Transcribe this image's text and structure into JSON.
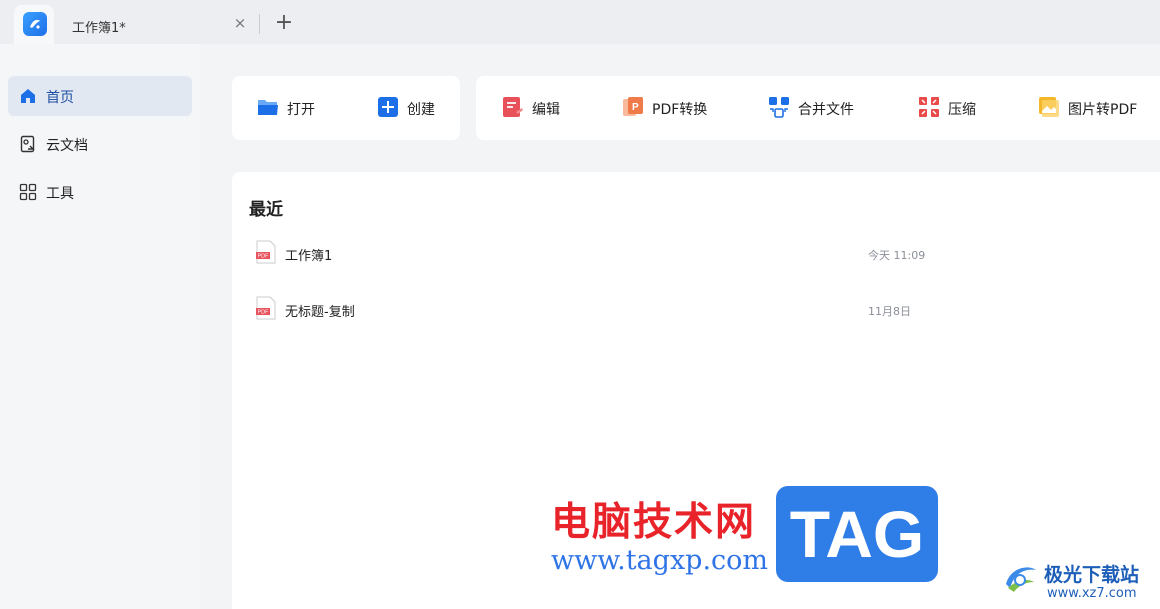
{
  "tabbar": {
    "doc_tab_title": "工作簿1*",
    "close_glyph": "×",
    "new_tab_glyph": "+"
  },
  "sidebar": {
    "items": [
      {
        "label": "首页",
        "icon": "home-icon",
        "active": true
      },
      {
        "label": "云文档",
        "icon": "cloud-doc-icon",
        "active": false
      },
      {
        "label": "工具",
        "icon": "grid-icon",
        "active": false
      }
    ]
  },
  "toolbar": {
    "open_label": "打开",
    "create_label": "创建",
    "edit_label": "编辑",
    "pdf_convert_label": "PDF转换",
    "merge_label": "合并文件",
    "compress_label": "压缩",
    "image_to_pdf_label": "图片转PDF"
  },
  "recent": {
    "title": "最近",
    "files": [
      {
        "name": "工作簿1",
        "time": "今天 11:09"
      },
      {
        "name": "无标题-复制",
        "time": "11月8日"
      }
    ]
  },
  "watermark": {
    "site_cn": "电脑技术网",
    "site_url": "www.tagxp.com",
    "tag": "TAG",
    "site2_cn": "极光下载站",
    "site2_url": "www.xz7.com"
  },
  "colors": {
    "accent": "#1d6fe8",
    "edit": "#e9515a",
    "pdf_convert": "#f07b4a",
    "compress": "#e94b4b",
    "image_pdf": "#f5b72a"
  }
}
